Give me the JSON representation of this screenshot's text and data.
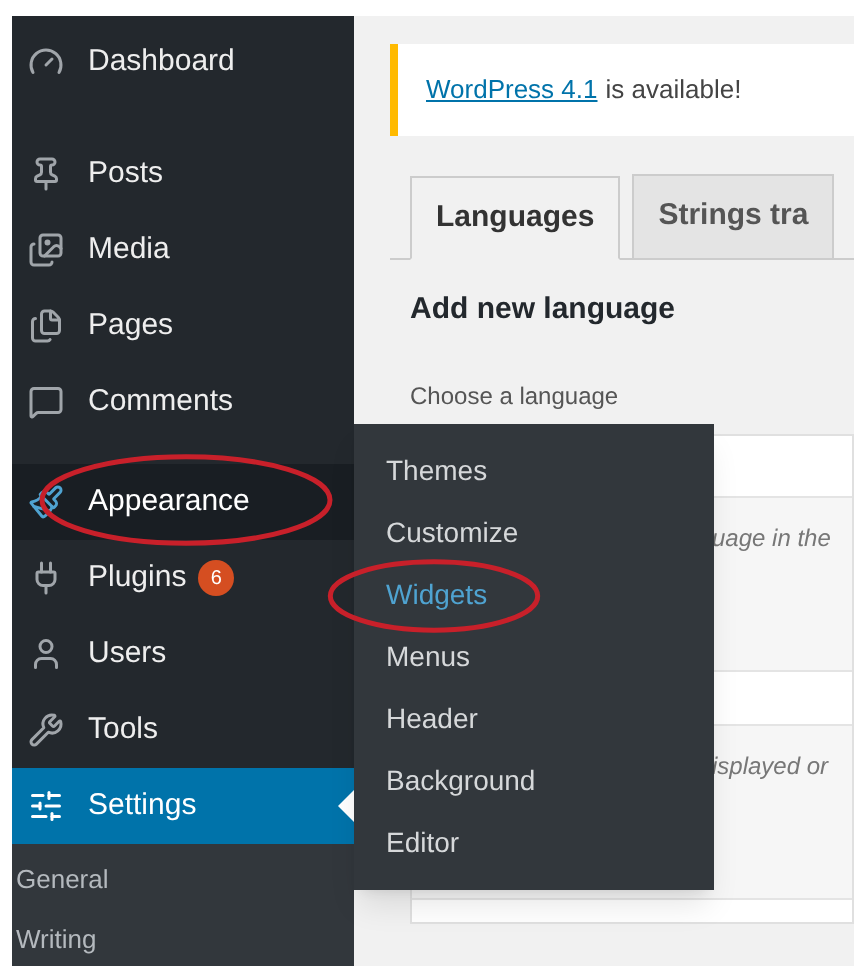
{
  "sidebar": {
    "items": [
      {
        "label": "Dashboard",
        "selected": false,
        "open": false,
        "circled": false
      },
      {
        "label": "Posts",
        "selected": false,
        "open": false,
        "circled": false
      },
      {
        "label": "Media",
        "selected": false,
        "open": false,
        "circled": false
      },
      {
        "label": "Pages",
        "selected": false,
        "open": false,
        "circled": false
      },
      {
        "label": "Comments",
        "selected": false,
        "open": false,
        "circled": false
      },
      {
        "label": "Appearance",
        "selected": false,
        "open": true,
        "circled": true,
        "flyout": [
          {
            "label": "Themes",
            "selected": false,
            "circled": false
          },
          {
            "label": "Customize",
            "selected": false,
            "circled": false
          },
          {
            "label": "Widgets",
            "selected": true,
            "circled": true
          },
          {
            "label": "Menus",
            "selected": false,
            "circled": false
          },
          {
            "label": "Header",
            "selected": false,
            "circled": false
          },
          {
            "label": "Background",
            "selected": false,
            "circled": false
          },
          {
            "label": "Editor",
            "selected": false,
            "circled": false
          }
        ]
      },
      {
        "label": "Plugins",
        "badge": "6",
        "selected": false,
        "open": false,
        "circled": false
      },
      {
        "label": "Users",
        "selected": false,
        "open": false,
        "circled": false
      },
      {
        "label": "Tools",
        "selected": false,
        "open": false,
        "circled": false
      },
      {
        "label": "Settings",
        "selected": true,
        "open": false,
        "circled": false,
        "submenu": [
          "General",
          "Writing"
        ]
      }
    ]
  },
  "notice": {
    "link": "WordPress 4.1",
    "text": "is available!"
  },
  "tabs": [
    {
      "label": "Languages",
      "selected": true
    },
    {
      "label": "Strings tra",
      "selected": false
    }
  ],
  "heading": "Add new language",
  "field_label": "Choose a language",
  "hints": [
    "uage in the",
    "isplayed or"
  ]
}
